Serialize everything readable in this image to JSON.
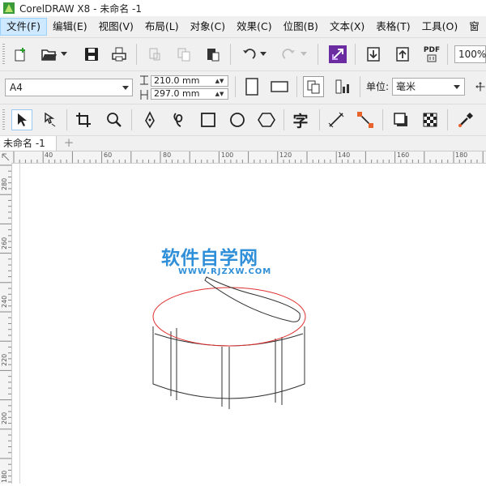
{
  "window": {
    "title": "CorelDRAW X8 - 未命名 -1"
  },
  "menu": {
    "items": [
      {
        "label": "文件(F)",
        "active": true
      },
      {
        "label": "编辑(E)"
      },
      {
        "label": "视图(V)"
      },
      {
        "label": "布局(L)"
      },
      {
        "label": "对象(C)"
      },
      {
        "label": "效果(C)"
      },
      {
        "label": "位图(B)"
      },
      {
        "label": "文本(X)"
      },
      {
        "label": "表格(T)"
      },
      {
        "label": "工具(O)"
      },
      {
        "label": "窗"
      }
    ]
  },
  "standard_toolbar": {
    "buttons": [
      "new-document-icon",
      "open-icon",
      "save-icon",
      "print-icon",
      "cut-icon",
      "copy-icon",
      "paste-icon",
      "undo-icon",
      "redo-icon",
      "launcher-icon",
      "import-icon",
      "export-icon",
      "publish-pdf-icon"
    ],
    "pdf_label": "PDF",
    "zoom_value": "100%"
  },
  "property_bar": {
    "page_size": "A4",
    "width": "210.0 mm",
    "height": "297.0 mm",
    "unit_label": "单位:",
    "unit_value": "毫米"
  },
  "toolbox": {
    "tools": [
      "pick-tool-icon",
      "shape-tool-icon",
      "crop-tool-icon",
      "zoom-tool-icon",
      "pen-tool-icon",
      "freehand-tool-icon",
      "rectangle-tool-icon",
      "ellipse-tool-icon",
      "polygon-tool-icon",
      "text-tool-icon",
      "dimension-tool-icon",
      "connector-tool-icon",
      "drop-shadow-tool-icon",
      "transparency-tool-icon",
      "eyedropper-tool-icon"
    ],
    "text_tool_glyph": "字"
  },
  "document_tabs": {
    "active_tab": "未命名 -1",
    "add_tab_glyph": "+"
  },
  "rulers": {
    "horizontal_ticks": [
      "40",
      "60",
      "80",
      "100",
      "120",
      "140",
      "160",
      "180"
    ],
    "vertical_ticks": [
      "280",
      "260",
      "240",
      "220",
      "200",
      "180"
    ]
  },
  "watermark": {
    "title": "软件自学网",
    "url": "WWW.RJZXW.COM"
  },
  "colors": {
    "menu_active_bg": "#cde8ff",
    "watermark": "#2f8fd8",
    "ellipse_outline": "#e03030",
    "accent_purple": "#6a2ca0"
  }
}
